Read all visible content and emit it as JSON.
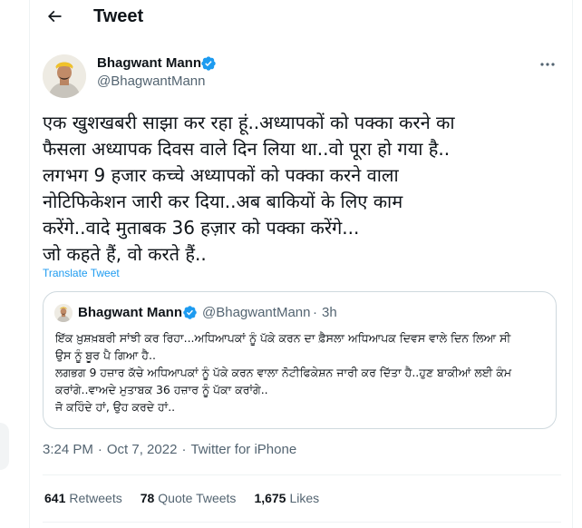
{
  "header": {
    "title": "Tweet"
  },
  "tweet": {
    "author_name": "Bhagwant Mann",
    "author_handle": "@BhagwantMann",
    "text_lines": [
      "एक खुशखबरी साझा कर रहा हूं..अध्यापकों को पक्का करने का",
      "फैसला अध्यापक दिवस वाले दिन लिया था..वो पूरा हो गया है..",
      "लगभग 9 हजार कच्चे अध्यापकों को पक्का करने वाला",
      "नोटिफिकेशन जारी कर दिया..अब बाकियों के लिए काम",
      "करेंगे..वादे मुताबक 36 हज़ार को पक्का करेंगे...",
      "जो कहते हैं, वो करते हैं.."
    ],
    "translate_label": "Translate Tweet",
    "time": "3:24 PM",
    "date": "Oct 7, 2022",
    "source": "Twitter for iPhone",
    "separator": "·"
  },
  "quote": {
    "author_name": "Bhagwant Mann",
    "author_handle": "@BhagwantMann",
    "separator": "·",
    "time": "3h",
    "text_lines": [
      "ਇੱਕ ਖ਼ੁਸ਼ਖ਼ਬਰੀ ਸਾਂਝੀ ਕਰ ਰਿਹਾ...ਅਧਿਆਪਕਾਂ ਨੂੰ ਪੱਕੇ ਕਰਨ ਦਾ ਫ਼ੈਸਲਾ ਅਧਿਆਪਕ ਦਿਵਸ ਵਾਲੇ ਦਿਨ ਲਿਆ ਸੀ",
      "ਉਸ ਨੂੰ ਬੂਰ ਪੈ ਗਿਆ ਹੈ..",
      "ਲਗਭਗ 9 ਹਜ਼ਾਰ ਕੱਚੇ ਅਧਿਆਪਕਾਂ ਨੂੰ ਪੱਕੇ ਕਰਨ ਵਾਲਾ ਨੋਟੀਫਿਕੇਸ਼ਨ ਜਾਰੀ ਕਰ ਦਿੱਤਾ ਹੈ..ਹੁਣ ਬਾਕੀਆਂ ਲਈ ਕੰਮ",
      "ਕਰਾਂਗੇ..ਵਾਅਦੇ ਮੁਤਾਬਕ 36 ਹਜ਼ਾਰ ਨੂੰ ਪੱਕਾ ਕਰਾਂਗੇ..",
      "ਜੋ ਕਹਿੰਦੇ ਹਾਂ, ਉਹ ਕਰਦੇ ਹਾਂ.."
    ]
  },
  "stats": {
    "retweets_count": "641",
    "retweets_label": "Retweets",
    "quotes_count": "78",
    "quotes_label": "Quote Tweets",
    "likes_count": "1,675",
    "likes_label": "Likes"
  },
  "icons": {
    "back": "arrow-left-icon",
    "verified": "verified-badge-icon",
    "more": "more-horizontal-icon"
  },
  "colors": {
    "accent": "#1d9bf0",
    "text": "#0f1419",
    "secondary": "#536471",
    "border": "#cfd9de"
  }
}
